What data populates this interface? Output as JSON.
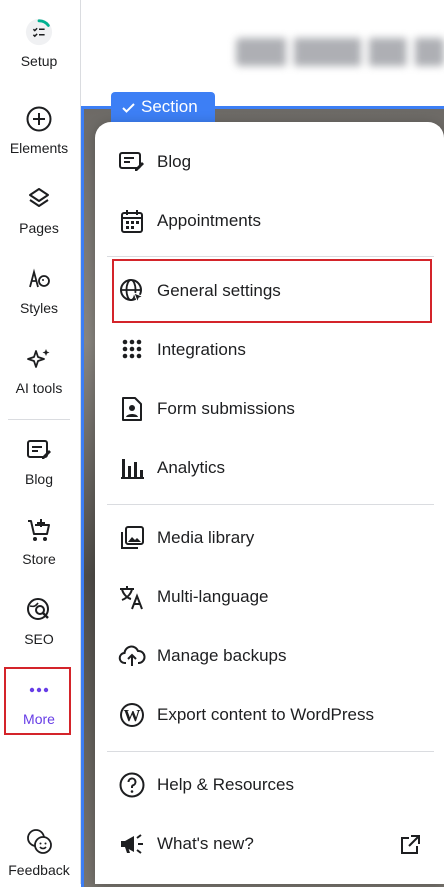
{
  "sidebar": {
    "items": [
      {
        "label": "Setup",
        "icon": "setup-checklist-icon"
      },
      {
        "label": "Elements",
        "icon": "plus-circle-icon"
      },
      {
        "label": "Pages",
        "icon": "layers-icon"
      },
      {
        "label": "Styles",
        "icon": "palette-icon"
      },
      {
        "label": "AI tools",
        "icon": "sparkles-icon"
      },
      {
        "label": "Blog",
        "icon": "blog-edit-icon"
      },
      {
        "label": "Store",
        "icon": "cart-plus-icon"
      },
      {
        "label": "SEO",
        "icon": "seo-globe-search-icon"
      },
      {
        "label": "More",
        "icon": "more-dots-icon"
      },
      {
        "label": "Feedback",
        "icon": "feedback-smile-icon"
      }
    ]
  },
  "canvas": {
    "section_tag": "Section"
  },
  "menu": {
    "items": [
      {
        "label": "Blog",
        "icon": "blog-edit-icon"
      },
      {
        "label": "Appointments",
        "icon": "calendar-icon"
      },
      {
        "label": "General settings",
        "icon": "globe-cursor-icon"
      },
      {
        "label": "Integrations",
        "icon": "grid-dots-icon"
      },
      {
        "label": "Form submissions",
        "icon": "form-user-icon"
      },
      {
        "label": "Analytics",
        "icon": "bar-chart-icon"
      },
      {
        "label": "Media library",
        "icon": "media-library-icon"
      },
      {
        "label": "Multi-language",
        "icon": "translate-icon"
      },
      {
        "label": "Manage backups",
        "icon": "cloud-upload-icon"
      },
      {
        "label": "Export content to WordPress",
        "icon": "wordpress-icon"
      },
      {
        "label": "Help & Resources",
        "icon": "help-circle-icon"
      },
      {
        "label": "What's new?",
        "icon": "megaphone-icon"
      }
    ]
  },
  "colors": {
    "accent": "#673de6",
    "section_blue": "#3d7ff5",
    "highlight_red": "#d4242a",
    "text": "#1d1e20"
  }
}
